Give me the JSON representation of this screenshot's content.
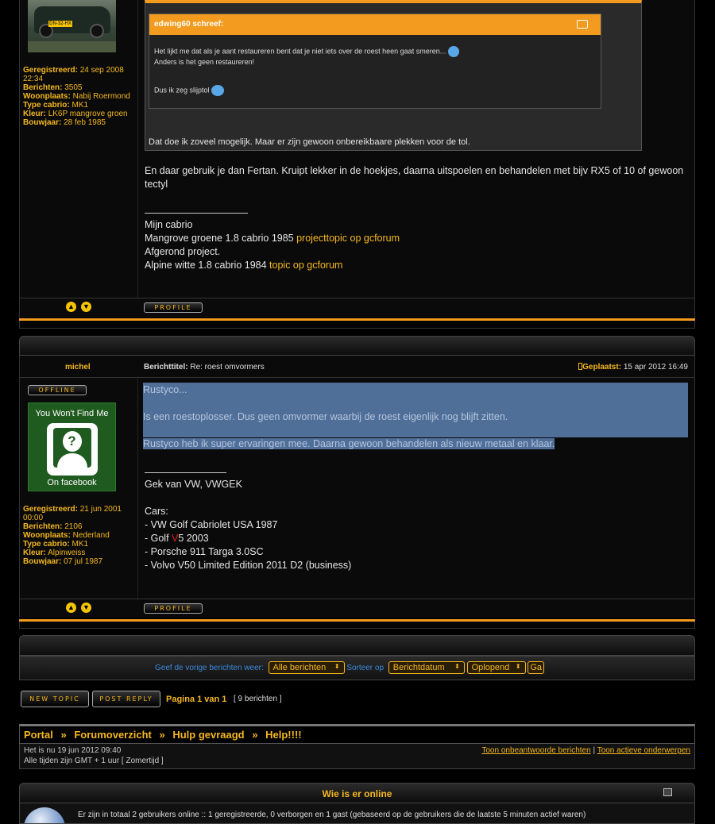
{
  "post1": {
    "user_info": [
      {
        "label": "Geregistreerd:",
        "value": "24 sep 2008 22:34"
      },
      {
        "label": "Berichten:",
        "value": "3505"
      },
      {
        "label": "Woonplaats:",
        "value": "Nabij Roermond"
      },
      {
        "label": "Type cabrio:",
        "value": "MK1"
      },
      {
        "label": "Kleur:",
        "value": "LK6P mangrove groen"
      },
      {
        "label": "Bouwjaar:",
        "value": "28 feb 1985"
      }
    ],
    "car_plate": "DN-32-HX",
    "quote_author": "edwing60 schreef:",
    "quote_lines": [
      "Het lijkt me dat als je aant restaureren bent dat je niet iets over de roest heen gaat smeren...",
      "Anders is het geen restaureren!",
      "Dus ik zeg slijptol"
    ],
    "outer_quote_text": "Dat doe ik zoveel mogelijk. Maar er zijn gewoon onbereikbaare plekken voor de tol.",
    "body": "En daar gebruik je dan Fertan. Kruipt lekker in de hoekjes, daarna uitspoelen en behandelen met bijv RX5 of 10 of gewoon tectyl",
    "sig": {
      "line1": "Mijn cabrio",
      "line2_text": "Mangrove groene 1.8 cabrio 1985 ",
      "line2_link": "projecttopic op gcforum",
      "line3": "Afgerond project.",
      "line4_text": "Alpine witte 1.8 cabrio 1984 ",
      "line4_link": "topic op gcforum"
    },
    "profile_label": "PROFILE"
  },
  "post2": {
    "username": "michel",
    "status": "OFFLINE",
    "avatar_top": "You Won't Find Me",
    "avatar_bottom": "On facebook",
    "subject_label": "Berichttitel:",
    "subject": "Re: roest omvormers",
    "posted_label": "Geplaatst:",
    "posted": "15 apr 2012 16:49",
    "user_info": [
      {
        "label": "Geregistreerd:",
        "value": "21 jun 2001 00:00"
      },
      {
        "label": "Berichten:",
        "value": "2106"
      },
      {
        "label": "Woonplaats:",
        "value": "Nederland"
      },
      {
        "label": "Type cabrio:",
        "value": "MK1"
      },
      {
        "label": "Kleur:",
        "value": "Alpinweiss"
      },
      {
        "label": "Bouwjaar:",
        "value": "07 jul 1987"
      }
    ],
    "body_lines": [
      "Rustyco...",
      "Is een roestoplosser. Dus geen omvormer waarbij de roest eigenlijk nog blijft zitten.",
      "Rustyco heb ik super ervaringen mee. Daarna gewoon behandelen als nieuw metaal en klaar."
    ],
    "sig": {
      "line1": "Gek van VW, VWGEK",
      "line2": "Cars:",
      "line3": "- VW Golf Cabriolet USA 1987",
      "line4_a": "- Golf ",
      "line4_v": "V",
      "line4_b": "5 2003",
      "line5": "- Porsche 911 Targa 3.0SC",
      "line6": "- Volvo V50 Limited Edition 2011 D2 (business)"
    },
    "profile_label": "PROFILE"
  },
  "sortbar": {
    "label": "Geef de vorige berichten weer:",
    "select1": "Alle berichten",
    "sort_label": "Sorteer op",
    "select2": "Berichtdatum",
    "select3": "Oplopend",
    "go": "Ga"
  },
  "actions": {
    "new_topic": "NEW TOPIC",
    "post_reply": "POST REPLY",
    "page_text": "Pagina 1 van 1",
    "post_count": "[ 9 berichten ]"
  },
  "breadcrumb": {
    "items": [
      "Portal",
      "Forumoverzicht",
      "Hulp gevraagd",
      "Help!!!!"
    ],
    "sep": "»"
  },
  "timeinfo": {
    "now": "Het is nu 19 jun 2012 09:40",
    "tz": "Alle tijden zijn GMT + 1 uur [ Zomertijd ]",
    "link1": "Toon onbeantwoorde berichten",
    "divider": "|",
    "link2": "Toon actieve onderwerpen"
  },
  "online": {
    "title": "Wie is er online",
    "text": "Er zijn in totaal 2 gebruikers online :: 1 geregistreerde, 0 verborgen en 1 gast (gebaseerd op de gebruikers die de laatste 5 minuten actief waren)"
  }
}
